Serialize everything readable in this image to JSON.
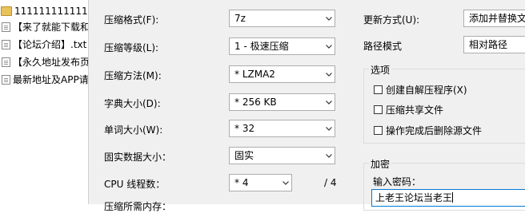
{
  "files": [
    {
      "name": "1111111111111",
      "type": "folder"
    },
    {
      "name": "【来了就能下载和",
      "type": "file"
    },
    {
      "name": "【论坛介绍】.txt",
      "type": "file"
    },
    {
      "name": "【永久地址发布页",
      "type": "file"
    },
    {
      "name": "最新地址及APP请",
      "type": "file"
    }
  ],
  "form": {
    "format_label": "压缩格式(F):",
    "format_value": "7z",
    "level_label": "压缩等级(L):",
    "level_value": "1 - 极速压缩",
    "method_label": "压缩方法(M):",
    "method_value": "* LZMA2",
    "dict_label": "字典大小(D):",
    "dict_value": "* 256 KB",
    "word_label": "单词大小(W):",
    "word_value": "* 32",
    "solid_label": "固实数据大小：",
    "solid_value": "固实",
    "cpu_label": "CPU 线程数：",
    "cpu_value": "* 4",
    "cpu_total": "/ 4",
    "memory_label": "压缩所需内存："
  },
  "right": {
    "update_label": "更新方式(U):",
    "update_value": "添加并替换文",
    "path_label": "路径模式",
    "path_value": "相对路径",
    "options_title": "选项",
    "option_sfx": "创建自解压程序(X)",
    "option_shared": "压缩共享文件",
    "option_delete": "操作完成后删除源文件",
    "encrypt_title": "加密",
    "password_label": "输入密码：",
    "password_value": "上老王论坛当老王"
  }
}
